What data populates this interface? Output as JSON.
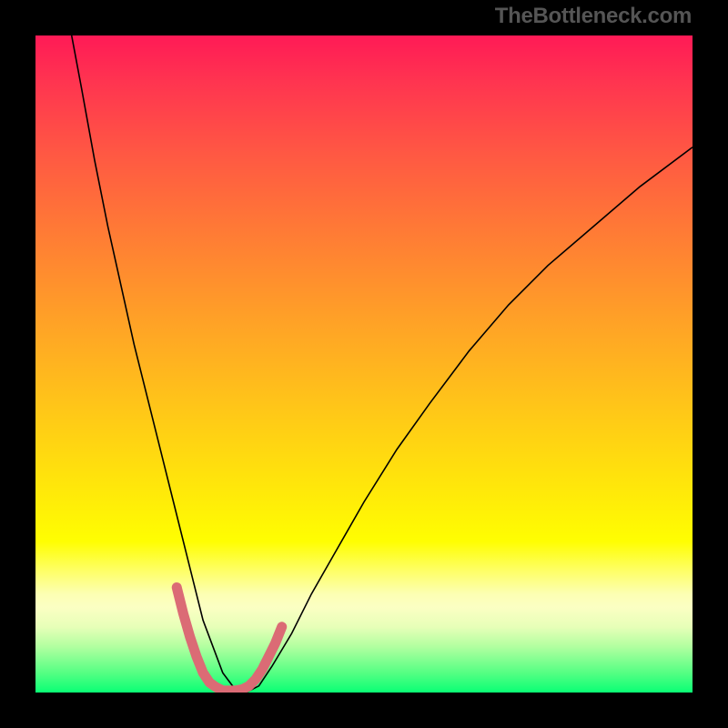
{
  "watermark": "TheBottleneck.com",
  "chart_data": {
    "type": "line",
    "title": "",
    "xlabel": "",
    "ylabel": "",
    "xlim": [
      0,
      100
    ],
    "ylim": [
      0,
      100
    ],
    "grid": false,
    "legend": false,
    "gradient_stops": [
      {
        "pos": 0,
        "color": "#FF1A56"
      },
      {
        "pos": 7,
        "color": "#FF3450"
      },
      {
        "pos": 18,
        "color": "#FF5843"
      },
      {
        "pos": 30,
        "color": "#FF7B35"
      },
      {
        "pos": 44,
        "color": "#FFA326"
      },
      {
        "pos": 57,
        "color": "#FFC718"
      },
      {
        "pos": 68,
        "color": "#FFE50B"
      },
      {
        "pos": 77,
        "color": "#FFFE01"
      },
      {
        "pos": 81,
        "color": "#FEFF5C"
      },
      {
        "pos": 85,
        "color": "#FCFFB3"
      },
      {
        "pos": 87,
        "color": "#FBFFC3"
      },
      {
        "pos": 90,
        "color": "#E7FFB8"
      },
      {
        "pos": 93,
        "color": "#B2FFA0"
      },
      {
        "pos": 97,
        "color": "#55FF83"
      },
      {
        "pos": 100,
        "color": "#0AFF75"
      }
    ],
    "series": [
      {
        "name": "bottleneck-curve",
        "stroke": "#000000",
        "stroke_width": 1.6,
        "x": [
          5.5,
          7,
          9,
          11,
          13,
          15,
          17,
          19,
          21,
          22.5,
          24,
          25.5,
          27,
          28.5,
          30,
          32,
          34,
          36,
          39,
          42,
          46,
          50,
          55,
          60,
          66,
          72,
          78,
          85,
          92,
          100
        ],
        "y": [
          100,
          92,
          81,
          71,
          62,
          53,
          45,
          37,
          29,
          23,
          17,
          11,
          7,
          3,
          1,
          0,
          1,
          4,
          9,
          15,
          22,
          29,
          37,
          44,
          52,
          59,
          65,
          71,
          77,
          83
        ]
      },
      {
        "name": "marker-band",
        "stroke": "#DB6B75",
        "stroke_width": 11,
        "linecap": "round",
        "x": [
          21.5,
          22.5,
          23.5,
          24.5,
          25.5,
          26.5,
          27.5,
          28.5,
          29.5,
          30.5,
          31.5,
          32.5,
          33.5,
          34.5,
          35.5,
          36.5,
          37.5
        ],
        "y": [
          16,
          12,
          8.5,
          5.5,
          3,
          1.5,
          0.8,
          0.3,
          0.3,
          0.3,
          0.5,
          1,
          2,
          3.5,
          5.5,
          7.5,
          10
        ]
      }
    ]
  }
}
